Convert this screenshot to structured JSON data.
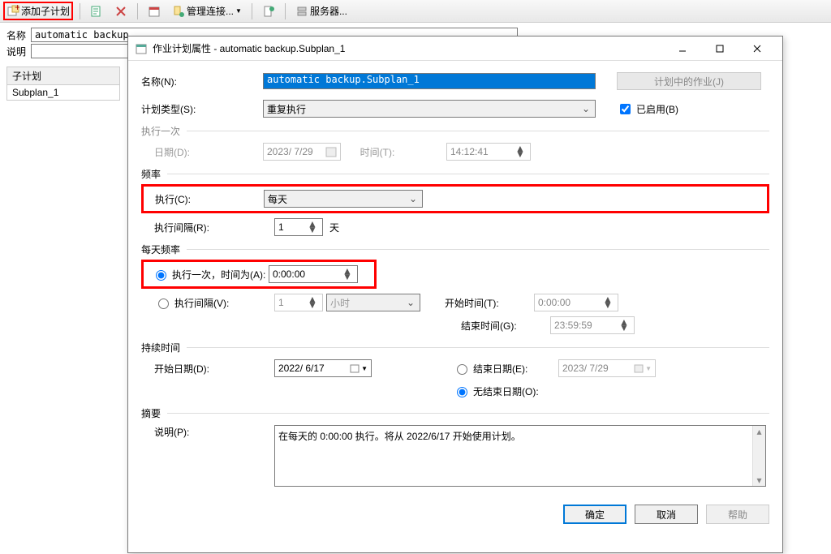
{
  "toolbar": {
    "add_subplan": "添加子计划",
    "manage_conn": "管理连接...",
    "server": "服务器..."
  },
  "main_form": {
    "name_label": "名称",
    "name_value": "automatic backup",
    "desc_label": "说明"
  },
  "subplan": {
    "header": "子计划",
    "row1": "Subplan_1"
  },
  "dialog": {
    "title": "作业计划属性 - automatic backup.Subplan_1",
    "name_label": "名称(N):",
    "name_value": "automatic backup.Subplan_1",
    "jobs_button": "计划中的作业(J)",
    "type_label": "计划类型(S):",
    "type_value": "重复执行",
    "enabled_label": "已启用(B)",
    "once": {
      "section": "执行一次",
      "date_label": "日期(D):",
      "date_value": "2023/ 7/29",
      "time_label": "时间(T):",
      "time_value": "14:12:41"
    },
    "freq": {
      "section": "频率",
      "exec_label": "执行(C):",
      "exec_value": "每天",
      "interval_label": "执行间隔(R):",
      "interval_value": "1",
      "interval_unit": "天"
    },
    "daily": {
      "section": "每天频率",
      "once_label": "执行一次，时间为(A):",
      "once_time": "0:00:00",
      "interval_label": "执行间隔(V):",
      "interval_value": "1",
      "interval_unit": "小时",
      "start_label": "开始时间(T):",
      "start_value": "0:00:00",
      "end_label": "结束时间(G):",
      "end_value": "23:59:59"
    },
    "duration": {
      "section": "持续时间",
      "start_label": "开始日期(D):",
      "start_value": "2022/ 6/17",
      "end_label": "结束日期(E):",
      "end_value": "2023/ 7/29",
      "noend_label": "无结束日期(O):"
    },
    "summary": {
      "section": "摘要",
      "desc_label": "说明(P):",
      "desc_value": "在每天的 0:00:00 执行。将从 2022/6/17 开始使用计划。"
    },
    "buttons": {
      "ok": "确定",
      "cancel": "取消",
      "help": "帮助"
    }
  }
}
